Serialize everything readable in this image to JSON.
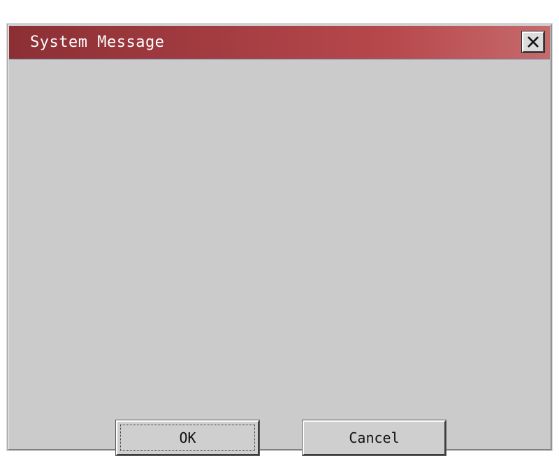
{
  "dialog": {
    "title": "System Message",
    "message": "",
    "buttons": {
      "ok_label": "OK",
      "cancel_label": "Cancel"
    }
  },
  "icons": {
    "close": "close-icon"
  },
  "colors": {
    "titlebar_start": "#8c2f35",
    "titlebar_end": "#c66a6c",
    "dialog_background": "#cbcbcb",
    "title_text": "#ffffff"
  }
}
